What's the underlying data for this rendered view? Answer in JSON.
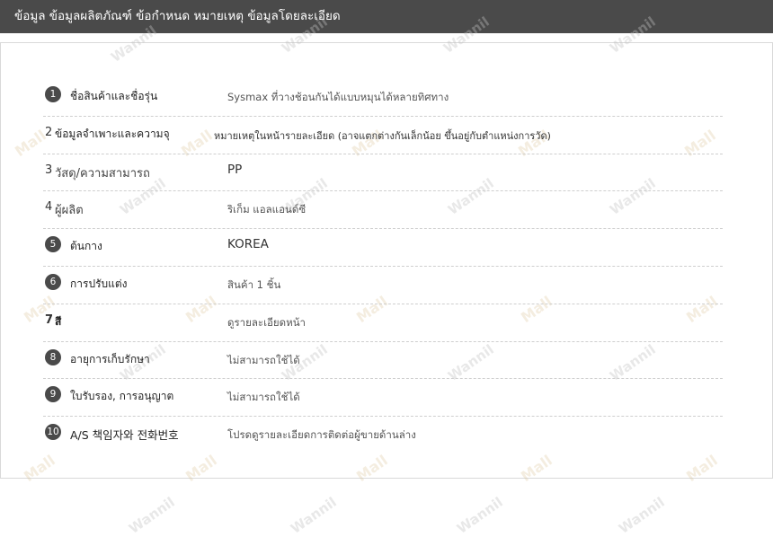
{
  "header": {
    "title": "ข้อมูล ข้อมูลผลิตภัณฑ์ ข้อกำหนด หมายเหตุ ข้อมูลโดยละเอียด"
  },
  "watermark": {
    "text": "Wannil",
    "mall_text": "Mall"
  },
  "rows": [
    {
      "num": "1",
      "label": "ชื่อสินค้าและชื่อรุ่น",
      "value": "Sysmax ที่วางช้อนกันได้แบบหมุนได้หลายทิศทาง"
    },
    {
      "num": "2",
      "label": "ข้อมูลจำเพาะและความจุ",
      "value": "หมายเหตุในหน้ารายละเอียด (อาจแตกต่างกันเล็กน้อย ขึ้นอยู่กับตำแหน่งการวัด)"
    },
    {
      "num": "3",
      "label": "วัสดุ/ความสามารถ",
      "value": "PP"
    },
    {
      "num": "4",
      "label": "ผู้ผลิต",
      "value": "ริเก็ม แอลแอนด์ซี"
    },
    {
      "num": "5",
      "label": "ต้นกาง",
      "value": "KOREA"
    },
    {
      "num": "6",
      "label": "การปรับแต่ง",
      "value": "สินค้า 1 ชิ้น"
    },
    {
      "num": "7",
      "label": "สี",
      "value": "ดูรายละเอียดหน้า"
    },
    {
      "num": "8",
      "label": "อายุการเก็บรักษา",
      "value": "ไม่สามารถใช้ได้"
    },
    {
      "num": "9",
      "label": "ใบรับรอง, การอนุญาต",
      "value": "ไม่สามารถใช้ได้"
    },
    {
      "num": "10",
      "label": "A/S 책임자와 전화번호",
      "value": "โปรดดูรายละเอียดการติดต่อผู้ขายด้านล่าง"
    }
  ]
}
